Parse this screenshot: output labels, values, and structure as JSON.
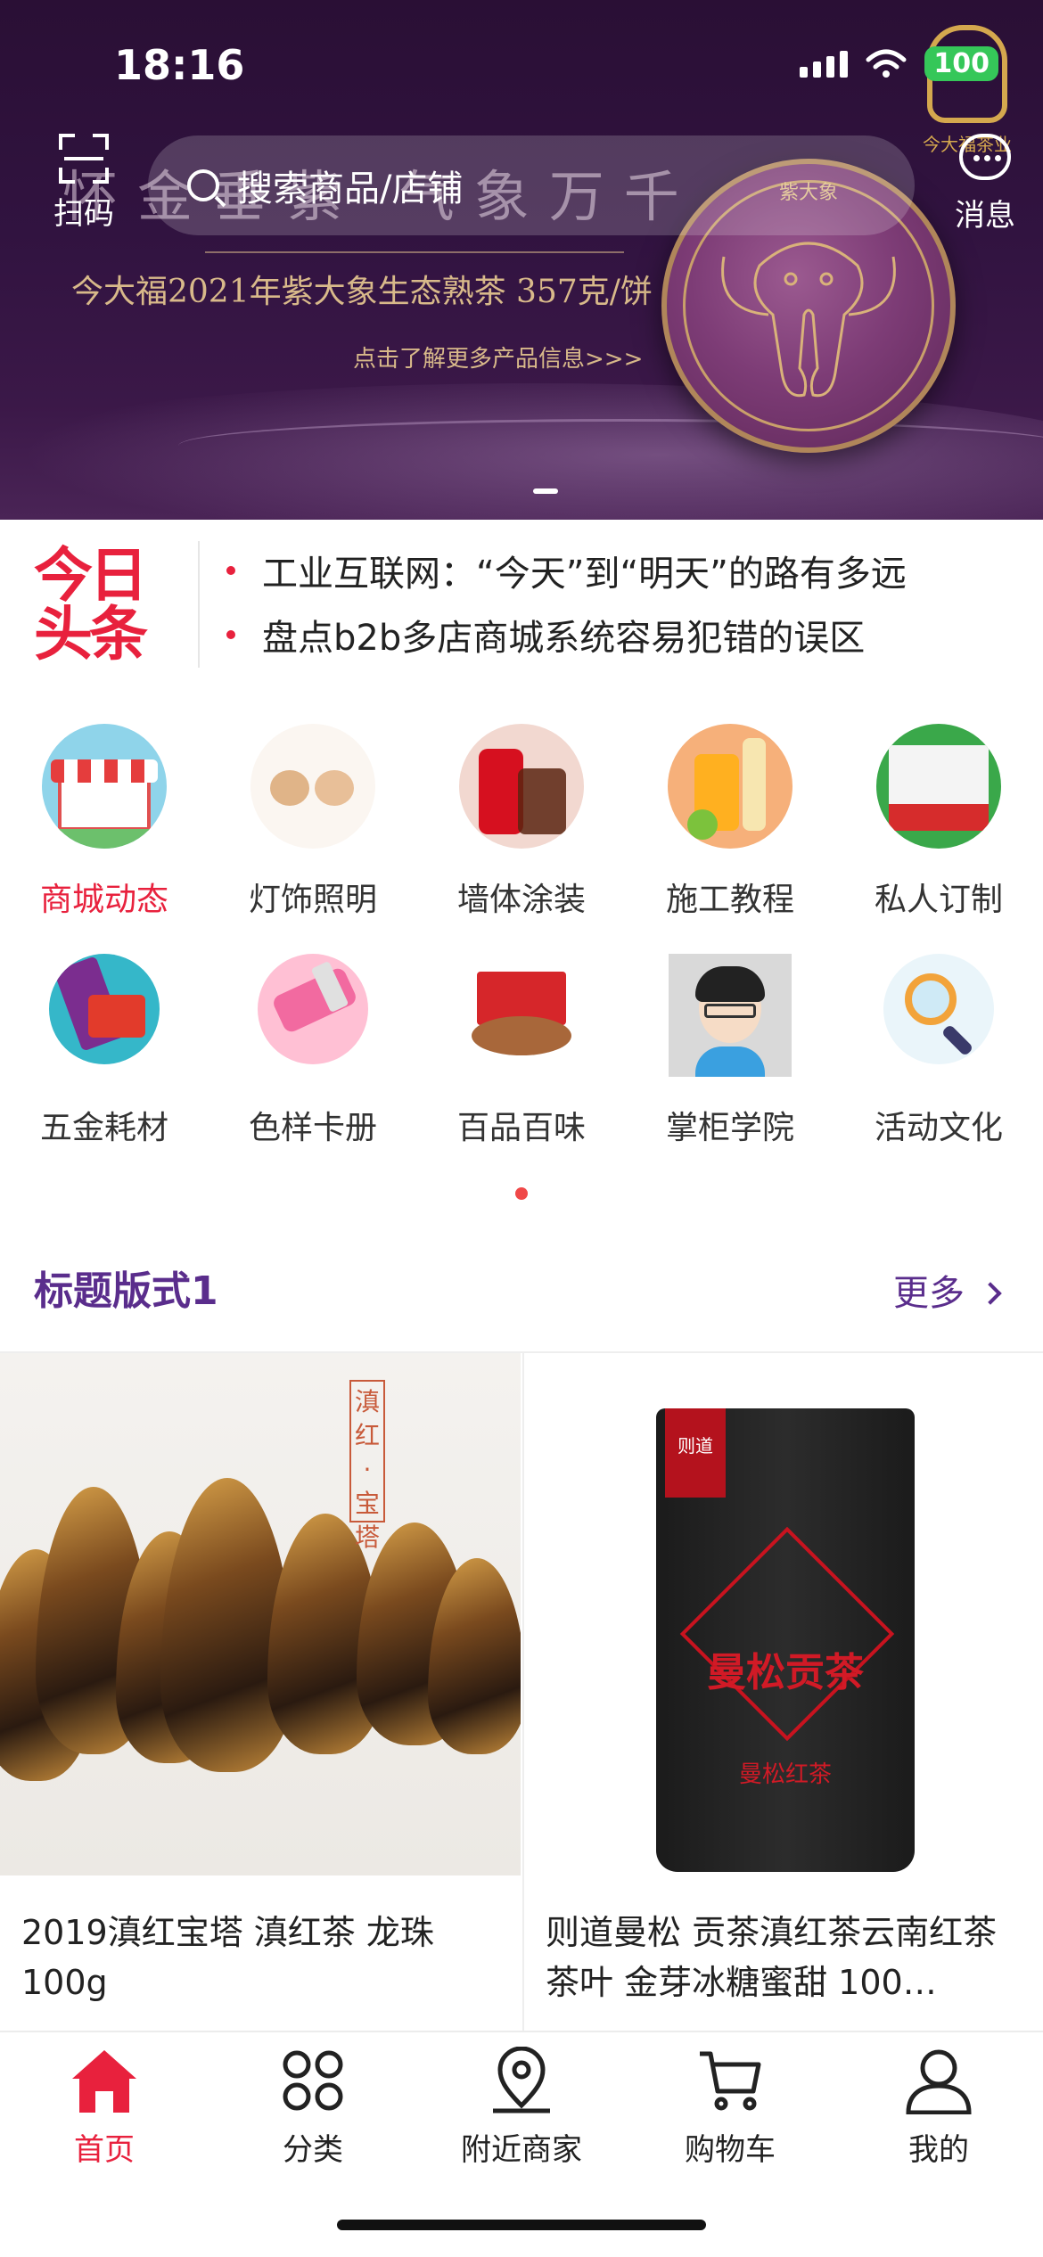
{
  "status_bar": {
    "time": "18:16",
    "battery": "100"
  },
  "header": {
    "scan_label": "扫码",
    "search_placeholder": "搜索商品/店铺",
    "message_label": "消息"
  },
  "banner": {
    "headline": "怀金垂紫 气象万千",
    "subtitle": "今大福2021年紫大象生态熟茶 357克/饼",
    "more_link": "点击了解更多产品信息>>>",
    "cake_label": "紫大象",
    "logo_text": "今大福茶业"
  },
  "headlines": {
    "logo_line1": "今日",
    "logo_line2": "头条",
    "items": [
      "工业互联网：“今天”到“明天”的路有多远",
      "盘点b2b多店商城系统容易犯错的误区"
    ]
  },
  "categories": [
    {
      "label": "商城动态",
      "icon": "storefront-icon",
      "active": true
    },
    {
      "label": "灯饰照明",
      "icon": "bears-icon",
      "active": false
    },
    {
      "label": "墙体涂装",
      "icon": "cola-icon",
      "active": false
    },
    {
      "label": "施工教程",
      "icon": "drinks-icon",
      "active": false
    },
    {
      "label": "私人订制",
      "icon": "gift-box-icon",
      "active": false
    },
    {
      "label": "五金耗材",
      "icon": "snacks-icon",
      "active": false
    },
    {
      "label": "色样卡册",
      "icon": "cosmetics-icon",
      "active": false
    },
    {
      "label": "百品百味",
      "icon": "nuts-icon",
      "active": false
    },
    {
      "label": "掌柜学院",
      "icon": "avatar-icon",
      "active": false
    },
    {
      "label": "活动文化",
      "icon": "magnifier-icon",
      "active": false
    }
  ],
  "section": {
    "title": "标题版式1",
    "more": "更多"
  },
  "products": [
    {
      "title": "2019滇红宝塔 滇红茶 龙珠 100g",
      "stamp": "滇红·宝塔"
    },
    {
      "title": "则道曼松 贡茶滇红茶云南红茶茶叶 金芽冰糖蜜甜 100…",
      "bag_name": "曼松贡茶",
      "bag_brand": "则道",
      "bag_sub": "曼松红茶"
    }
  ],
  "tabbar": [
    {
      "label": "首页",
      "icon": "home-icon",
      "active": true
    },
    {
      "label": "分类",
      "icon": "grid-icon",
      "active": false
    },
    {
      "label": "附近商家",
      "icon": "location-pin-icon",
      "active": false
    },
    {
      "label": "购物车",
      "icon": "cart-icon",
      "active": false
    },
    {
      "label": "我的",
      "icon": "user-icon",
      "active": false
    }
  ],
  "colors": {
    "accent": "#e8213d",
    "section_purple": "#5a2d8c",
    "banner_bg": "#311340"
  }
}
